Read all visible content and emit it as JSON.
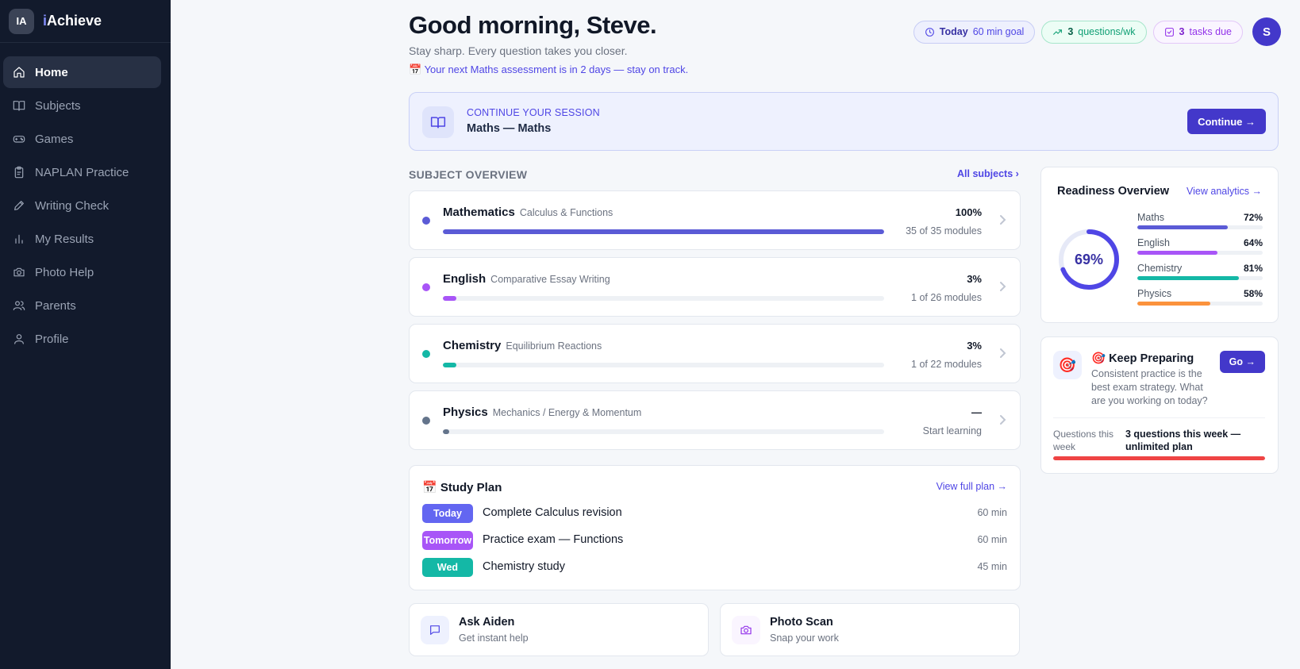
{
  "brand": {
    "badge": "IA",
    "name_prefix": "i",
    "name_rest": "Achieve"
  },
  "sidebar": {
    "items": [
      {
        "label": "Home",
        "icon": "home-icon",
        "active": true
      },
      {
        "label": "Subjects",
        "icon": "book-icon"
      },
      {
        "label": "Games",
        "icon": "gamepad-icon"
      },
      {
        "label": "NAPLAN Practice",
        "icon": "clipboard-icon"
      },
      {
        "label": "Writing Check",
        "icon": "pencil-icon"
      },
      {
        "label": "My Results",
        "icon": "bar-chart-icon"
      },
      {
        "label": "Photo Help",
        "icon": "camera-icon"
      },
      {
        "label": "Parents",
        "icon": "users-icon"
      },
      {
        "label": "Profile",
        "icon": "user-icon"
      }
    ]
  },
  "header": {
    "greeting": "Good morning, Steve.",
    "tagline": "Stay sharp. Every question takes you closer.",
    "notice": "📅 Your next Maths assessment is in 2 days — stay on track.",
    "pills": {
      "goal": {
        "strong": "Today",
        "text": "60 min goal"
      },
      "questions": {
        "strong": "3",
        "text": "questions/wk"
      },
      "tasks": {
        "strong": "3",
        "text": "tasks due"
      }
    },
    "avatar": "S"
  },
  "continue_session": {
    "kicker": "CONTINUE YOUR SESSION",
    "title": "Maths — Maths",
    "button": "Continue →"
  },
  "subject_overview": {
    "title": "SUBJECT OVERVIEW",
    "link": "All subjects",
    "subjects": [
      {
        "name": "Mathematics",
        "topic": "Calculus & Functions",
        "percent_label": "100%",
        "progress": 100,
        "modules": "35 of 35 modules",
        "color": "#5b5bd6"
      },
      {
        "name": "English",
        "topic": "Comparative Essay Writing",
        "percent_label": "3%",
        "progress": 3,
        "modules": "1 of 26 modules",
        "color": "#a855f7"
      },
      {
        "name": "Chemistry",
        "topic": "Equilibrium Reactions",
        "percent_label": "3%",
        "progress": 3,
        "modules": "1 of 22 modules",
        "color": "#14b8a6"
      },
      {
        "name": "Physics",
        "topic": "Mechanics / Energy & Momentum",
        "percent_label": "—",
        "progress": 1.5,
        "modules": "Start learning",
        "color": "#64748b"
      }
    ]
  },
  "study_plan": {
    "title": "📅 Study Plan",
    "link": "View full plan →",
    "items": [
      {
        "tag": "Today",
        "task": "Complete Calculus revision",
        "duration": "60 min",
        "color": "#6366f1"
      },
      {
        "tag": "Tomorrow",
        "task": "Practice exam — Functions",
        "duration": "60 min",
        "color": "#a855f7"
      },
      {
        "tag": "Wed",
        "task": "Chemistry study",
        "duration": "45 min",
        "color": "#14b8a6"
      }
    ]
  },
  "quick_actions": [
    {
      "title": "Ask Aiden",
      "subtitle": "Get instant help",
      "icon": "chat-icon"
    },
    {
      "title": "Photo Scan",
      "subtitle": "Snap your work",
      "icon": "camera-icon"
    }
  ],
  "readiness": {
    "title": "Readiness Overview",
    "link": "View analytics →",
    "overall_label": "69%",
    "overall": 69,
    "bars": [
      {
        "name": "Maths",
        "label": "72%",
        "value": 72,
        "color": "#5b5bd6"
      },
      {
        "name": "English",
        "label": "64%",
        "value": 64,
        "color": "#a855f7"
      },
      {
        "name": "Chemistry",
        "label": "81%",
        "value": 81,
        "color": "#14b8a6"
      },
      {
        "name": "Physics",
        "label": "58%",
        "value": 58,
        "color": "#fb923c"
      }
    ]
  },
  "keep_preparing": {
    "icon": "🎯",
    "title": "🎯 Keep Preparing",
    "text": "Consistent practice is the best exam strategy. What are you working on today?",
    "button": "Go →",
    "questions_label": "Questions this week",
    "questions_value": "3 questions this week — unlimited plan",
    "progress": 100
  }
}
